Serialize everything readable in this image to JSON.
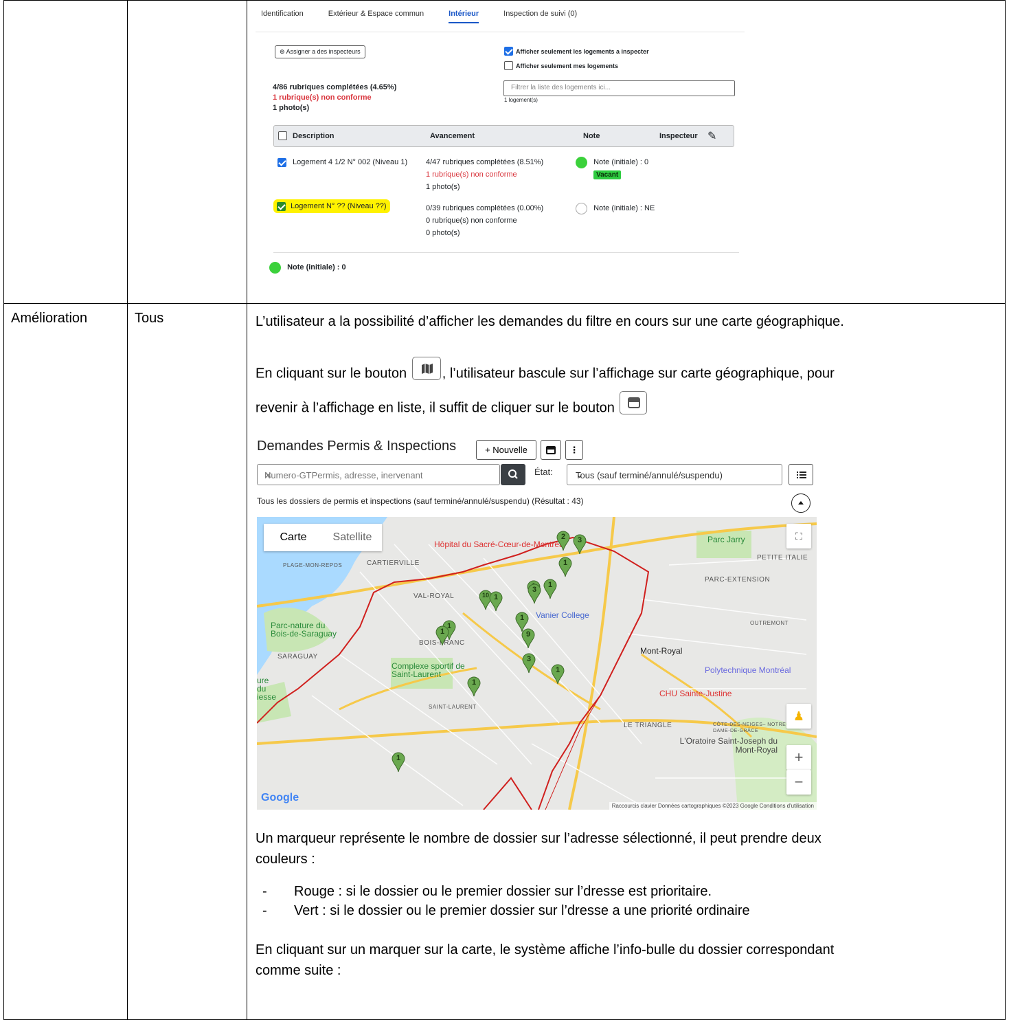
{
  "table": {
    "row2": {
      "type": "Amélioration",
      "scope": "Tous"
    }
  },
  "inspection": {
    "tabs": [
      "Identification",
      "Extérieur & Espace commun",
      "Intérieur",
      "Inspection de suivi (0)"
    ],
    "assign_button": "Assigner a des inspecteurs",
    "check_only_to_inspect": "Afficher seulement les logements a inspecter",
    "check_only_mine": "Afficher seulement mes logements",
    "stats": {
      "completed": "4/86 rubriques complétées (4.65%)",
      "nonconform": "1 rubrique(s) non conforme",
      "photos": "1 photo(s)"
    },
    "filter_placeholder": "Filtrer la liste des logements ici...",
    "filter_count": "1 logement(s)",
    "columns": [
      "Description",
      "Avancement",
      "Note",
      "Inspecteur"
    ],
    "rows": [
      {
        "description": "Logement 4 1/2 N° 002 (Niveau 1)",
        "progress": "4/47 rubriques complétées (8.51%)",
        "nonconform": "1 rubrique(s) non conforme",
        "photos": "1 photo(s)",
        "note": "Note (initiale) : 0",
        "badge": "Vacant"
      },
      {
        "description": "Logement N° ?? (Niveau ??)",
        "progress": "0/39 rubriques complétées (0.00%)",
        "nonconform": "0 rubrique(s) non conforme",
        "photos": "0 photo(s)",
        "note": "Note (initiale) : NE"
      }
    ],
    "footer_note": "Note (initiale) : 0"
  },
  "text": {
    "intro": "L’utilisateur a la possibilité d’afficher les demandes du filtre en cours sur une carte géographique.",
    "p2_a": "En cliquant sur le bouton",
    "p2_b": ", l’utilisateur bascule sur l’affichage sur carte géographique, pour",
    "p2_c": "revenir à l’affichage en liste, il suffit de cliquer sur le bouton",
    "marker_a": "Un marqueur représente le nombre de dossier sur l’adresse sélectionné, il peut prendre deux",
    "marker_b": "couleurs :",
    "bullet_dash": "-",
    "bullet_red": "Rouge : si le dossier ou le premier dossier sur l’dresse est prioritaire.",
    "bullet_green": "Vert : si le dossier ou le premier dossier sur l’dresse a une priorité ordinaire",
    "click_a": "En cliquant sur un marquer sur la carte, le système affiche l’info-bulle du dossier correspondant",
    "click_b": "comme suite :"
  },
  "mapscreen": {
    "title": "Demandes Permis & Inspections",
    "new_button": "+ Nouvelle",
    "search_placeholder": "Numero-GTPermis, adresse, inervenant",
    "etat_label": "État:",
    "etat_value": "Tous (sauf terminé/annulé/suspendu)",
    "result_text": "Tous les dossiers de permis et inspections (sauf terminé/annulé/suspendu) (Résultat : 43)",
    "map_tabs": [
      "Carte",
      "Satellite"
    ],
    "labels": {
      "hospital": "Hôpital du Sacré-Cœur-de-Montréal",
      "cartierville": "CARTIERVILLE",
      "plage": "PLAGE-MON-REPOS",
      "valroyal": "VAL-ROYAL",
      "parcnature": "Parc-nature du Bois-de-Saraguay",
      "saraguay": "SARAGUAY",
      "boisfranc": "BOIS-FRANC",
      "complexe": "Complexe sportif de Saint-Laurent",
      "saintlaurent": "SAINT-LAURENT",
      "vanier": "Vanier College",
      "parcjarry": "Parc Jarry",
      "petiteitalie": "PETITE ITALIE",
      "parcext": "PARC-EXTENSION",
      "outremont": "OUTREMONT",
      "montroyal": "Mont-Royal",
      "poly": "Polytechnique Montréal",
      "chu": "CHU Sainte-Justine",
      "triangle": "LE TRIANGLE",
      "cdn": "CÔTE-DES-NEIGES– NOTRE-DAME-DE-GRÂCE",
      "oratoire": "L'Oratoire Saint-Joseph du Mont-Royal",
      "ruelahaie": "ure du iesse",
      "google": "Google",
      "attribution": "Raccourcis clavier   Données cartographiques ©2023 Google   Conditions d'utilisation"
    },
    "markers": [
      "2",
      "3",
      "1",
      "1",
      "1",
      "3",
      "10",
      "1",
      "1",
      "9",
      "1",
      "1",
      "3",
      "1",
      "1",
      "1"
    ],
    "marker_color": "#6aa84f"
  }
}
